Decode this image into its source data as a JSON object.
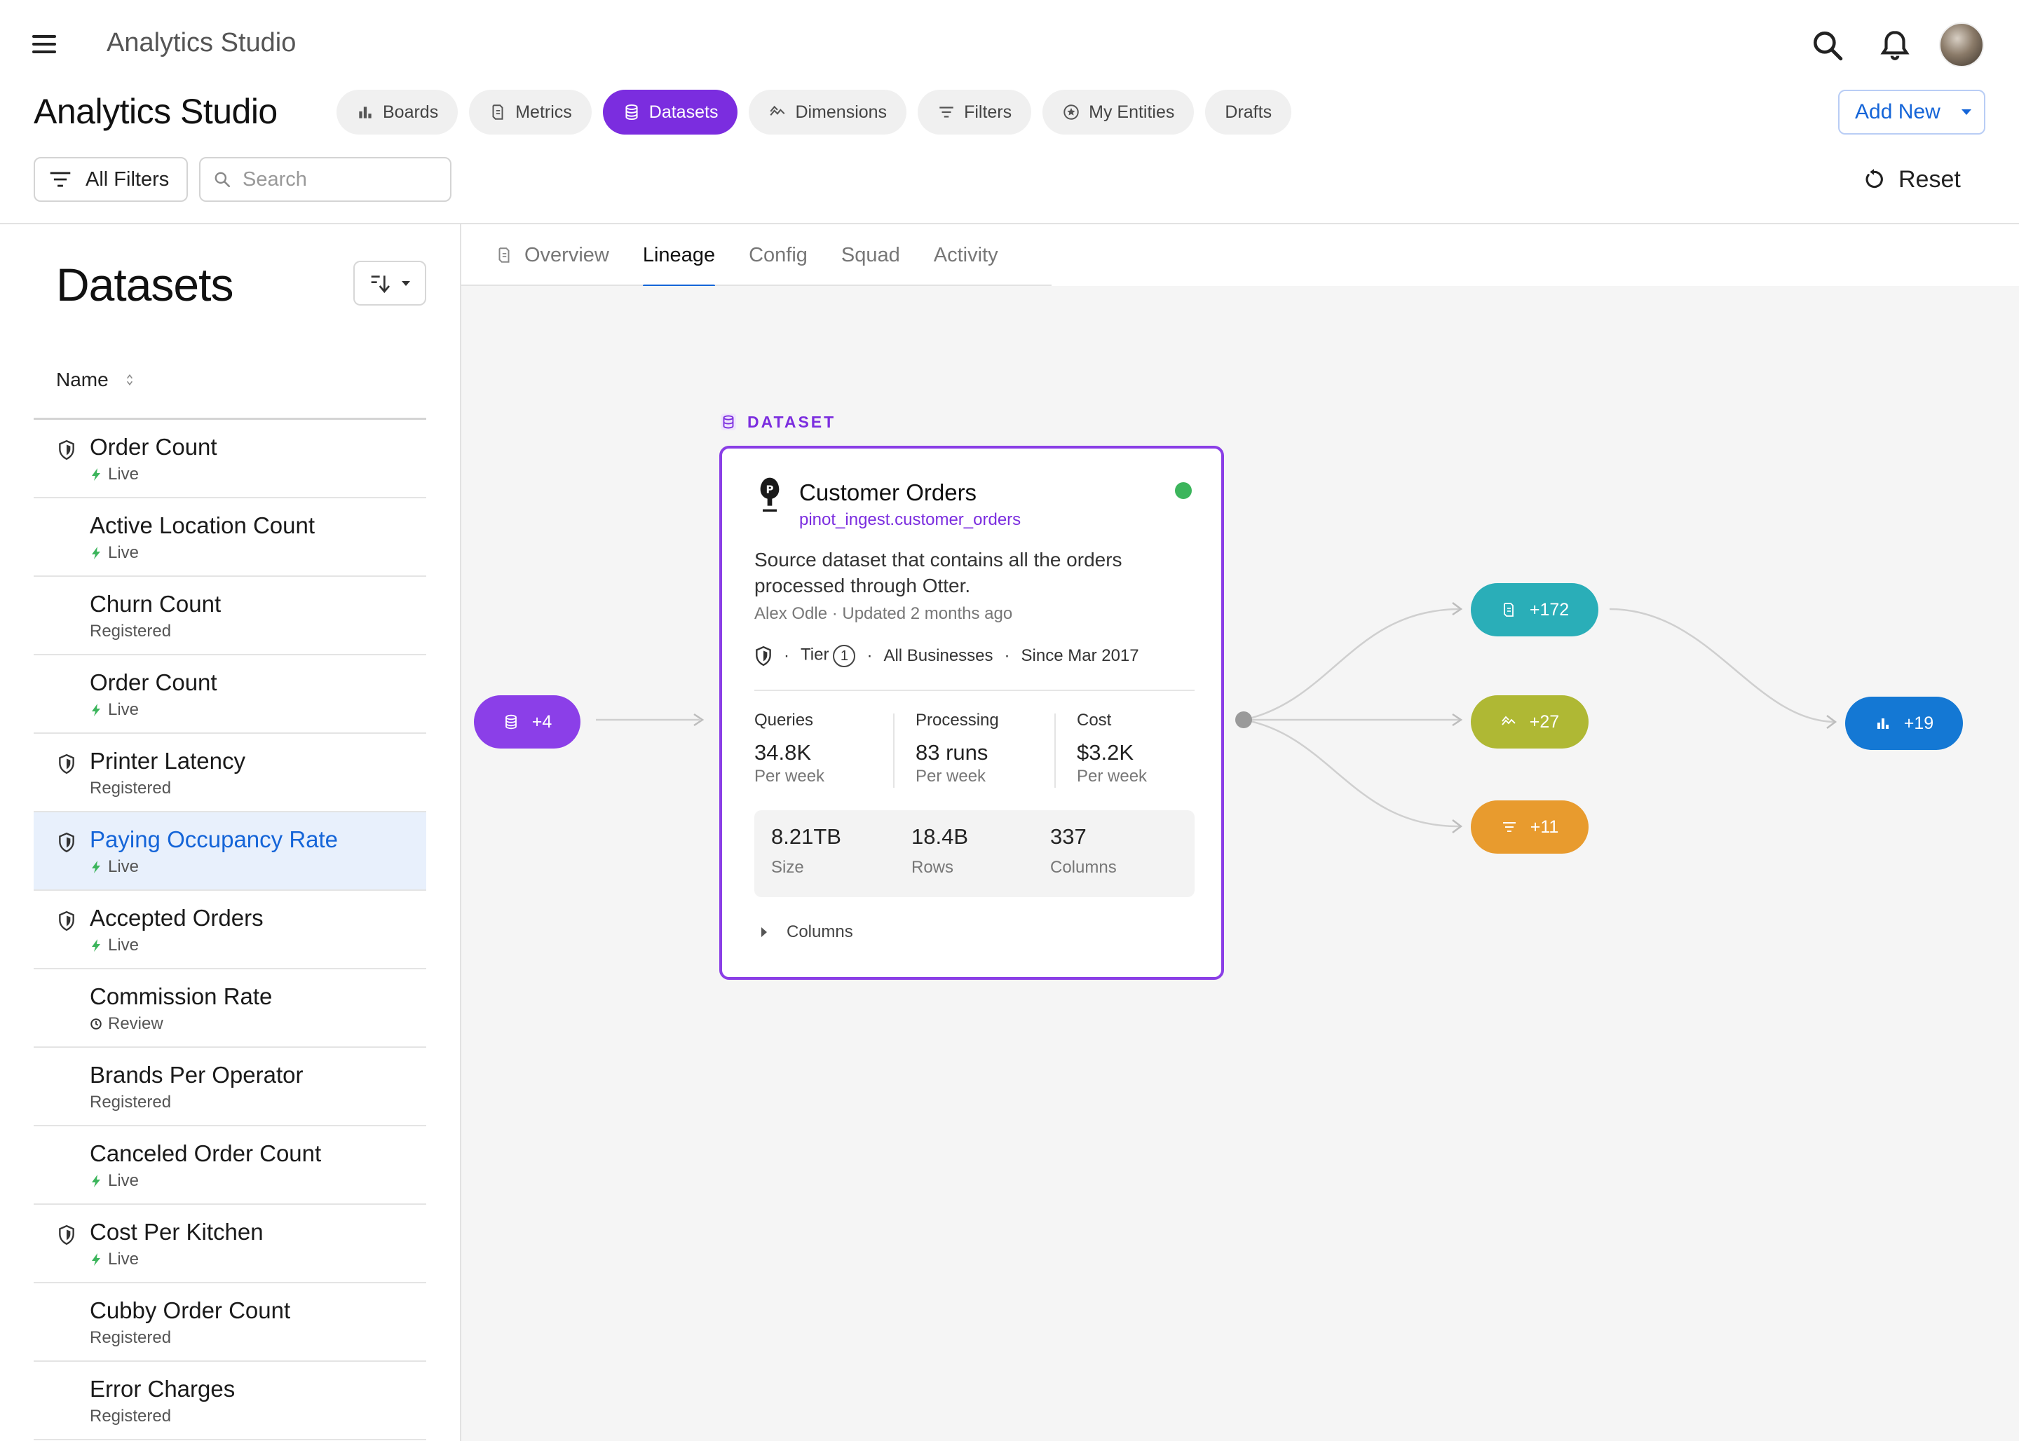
{
  "app": {
    "title": "Analytics Studio",
    "heading": "Analytics Studio"
  },
  "nav": {
    "pills": [
      {
        "label": "Boards",
        "icon": "bar-chart-icon",
        "active": false
      },
      {
        "label": "Metrics",
        "icon": "metric-icon",
        "active": false
      },
      {
        "label": "Datasets",
        "icon": "database-icon",
        "active": true
      },
      {
        "label": "Dimensions",
        "icon": "dimension-icon",
        "active": false
      },
      {
        "label": "Filters",
        "icon": "filter-icon",
        "active": false
      },
      {
        "label": "My Entities",
        "icon": "star-circle-icon",
        "active": false
      },
      {
        "label": "Drafts",
        "icon": "",
        "active": false
      }
    ],
    "add_new_label": "Add New"
  },
  "filters": {
    "all_filters_label": "All Filters",
    "search_placeholder": "Search",
    "search_value": "",
    "reset_label": "Reset"
  },
  "datasets_panel": {
    "title": "Datasets",
    "column_header": "Name",
    "items": [
      {
        "name": "Order Count",
        "status": "Live",
        "certified": true,
        "selected": false
      },
      {
        "name": "Active Location Count",
        "status": "Live",
        "certified": false,
        "selected": false
      },
      {
        "name": "Churn Count",
        "status": "Registered",
        "certified": false,
        "selected": false
      },
      {
        "name": "Order Count",
        "status": "Live",
        "certified": false,
        "selected": false
      },
      {
        "name": "Printer Latency",
        "status": "Registered",
        "certified": true,
        "selected": false
      },
      {
        "name": "Paying Occupancy Rate",
        "status": "Live",
        "certified": true,
        "selected": true
      },
      {
        "name": "Accepted Orders",
        "status": "Live",
        "certified": true,
        "selected": false
      },
      {
        "name": "Commission Rate",
        "status": "Review",
        "certified": false,
        "selected": false
      },
      {
        "name": "Brands Per Operator",
        "status": "Registered",
        "certified": false,
        "selected": false
      },
      {
        "name": "Canceled Order Count",
        "status": "Live",
        "certified": false,
        "selected": false
      },
      {
        "name": "Cost Per Kitchen",
        "status": "Live",
        "certified": true,
        "selected": false
      },
      {
        "name": "Cubby Order Count",
        "status": "Registered",
        "certified": false,
        "selected": false
      },
      {
        "name": "Error Charges",
        "status": "Registered",
        "certified": false,
        "selected": false
      }
    ]
  },
  "detail_tabs": [
    {
      "label": "Overview",
      "active": false
    },
    {
      "label": "Lineage",
      "active": true
    },
    {
      "label": "Config",
      "active": false
    },
    {
      "label": "Squad",
      "active": false
    },
    {
      "label": "Activity",
      "active": false
    }
  ],
  "lineage": {
    "upstream": {
      "label": "+4",
      "icon": "database-icon",
      "color": "#8b3fe8"
    },
    "downstream": [
      {
        "label": "+172",
        "icon": "metric-icon",
        "color": "#2aaeb8"
      },
      {
        "label": "+27",
        "icon": "dimension-icon",
        "color": "#afb834"
      },
      {
        "label": "+11",
        "icon": "filter-icon",
        "color": "#e89b2e"
      }
    ],
    "final": {
      "label": "+19",
      "icon": "bar-chart-icon",
      "color": "#1478d4"
    },
    "card": {
      "type_label": "DATASET",
      "name": "Customer Orders",
      "path": "pinot_ingest.customer_orders",
      "description": "Source dataset that contains all the orders processed through Otter.",
      "meta": "Alex Odle · Updated 2 months ago",
      "tier_label": "Tier",
      "tier_value": "1",
      "scope": "All Businesses",
      "since": "Since Mar 2017",
      "stats": [
        {
          "label": "Queries",
          "value": "34.8K",
          "sub": "Per week"
        },
        {
          "label": "Processing",
          "value": "83 runs",
          "sub": "Per week"
        },
        {
          "label": "Cost",
          "value": "$3.2K",
          "sub": "Per week"
        }
      ],
      "size_stats": [
        {
          "value": "8.21TB",
          "sub": "Size"
        },
        {
          "value": "18.4B",
          "sub": "Rows"
        },
        {
          "value": "337",
          "sub": "Columns"
        }
      ],
      "columns_toggle": "Columns",
      "status_color": "#3cb55c"
    }
  },
  "colors": {
    "accent": "#7b2ddf",
    "link": "#1565d8",
    "live": "#3cb55c"
  }
}
